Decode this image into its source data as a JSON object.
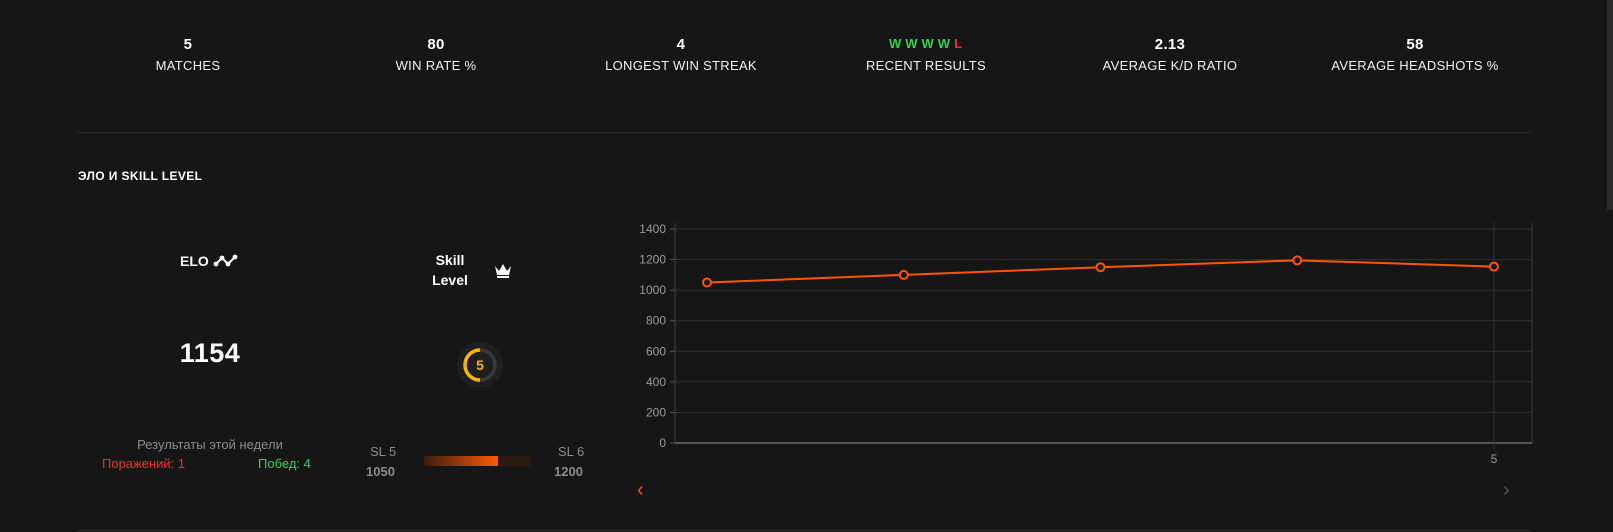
{
  "stats": {
    "matches": {
      "value": "5",
      "label": "MATCHES"
    },
    "win_rate": {
      "value": "80",
      "label": "WIN RATE %"
    },
    "longest_streak": {
      "value": "4",
      "label": "LONGEST WIN STREAK"
    },
    "recent_results": {
      "label": "RECENT RESULTS",
      "results": [
        "W",
        "W",
        "W",
        "W",
        "L"
      ]
    },
    "avg_kd": {
      "value": "2.13",
      "label": "AVERAGE K/D RATIO"
    },
    "avg_hs": {
      "value": "58",
      "label": "AVERAGE HEADSHOTS %"
    }
  },
  "section": {
    "title": "ЭЛО И SKILL LEVEL"
  },
  "elo": {
    "label": "ELO",
    "value": "1154",
    "icon": "trend-line-icon"
  },
  "skill": {
    "label": "Skill Level",
    "level": "5",
    "level_fraction": 0.5,
    "icon": "crown-icon",
    "color": "#f5b800"
  },
  "week": {
    "title": "Результаты этой недели",
    "losses": "Поражений: 1",
    "wins": "Побед: 4"
  },
  "progress": {
    "left_name": "SL 5",
    "left_value": "1050",
    "right_name": "SL 6",
    "right_value": "1200",
    "fraction": 0.69
  },
  "colors": {
    "accent": "#ff5500",
    "win": "#32d35a",
    "loss": "#ff2b2b"
  },
  "chart_data": {
    "type": "line",
    "x": [
      1,
      2,
      3,
      4,
      5
    ],
    "x_tick_labels": [
      "",
      "",
      "",
      "",
      "5"
    ],
    "yticks": [
      0,
      200,
      400,
      600,
      800,
      1000,
      1200,
      1400
    ],
    "ylim": [
      0,
      1400
    ],
    "series": [
      {
        "values": [
          1050,
          1100,
          1150,
          1195,
          1154
        ],
        "color": "#ff5500"
      }
    ],
    "grid": true,
    "title": "",
    "xlabel": "",
    "ylabel": ""
  },
  "nav": {
    "prev": "‹",
    "next": "›"
  }
}
